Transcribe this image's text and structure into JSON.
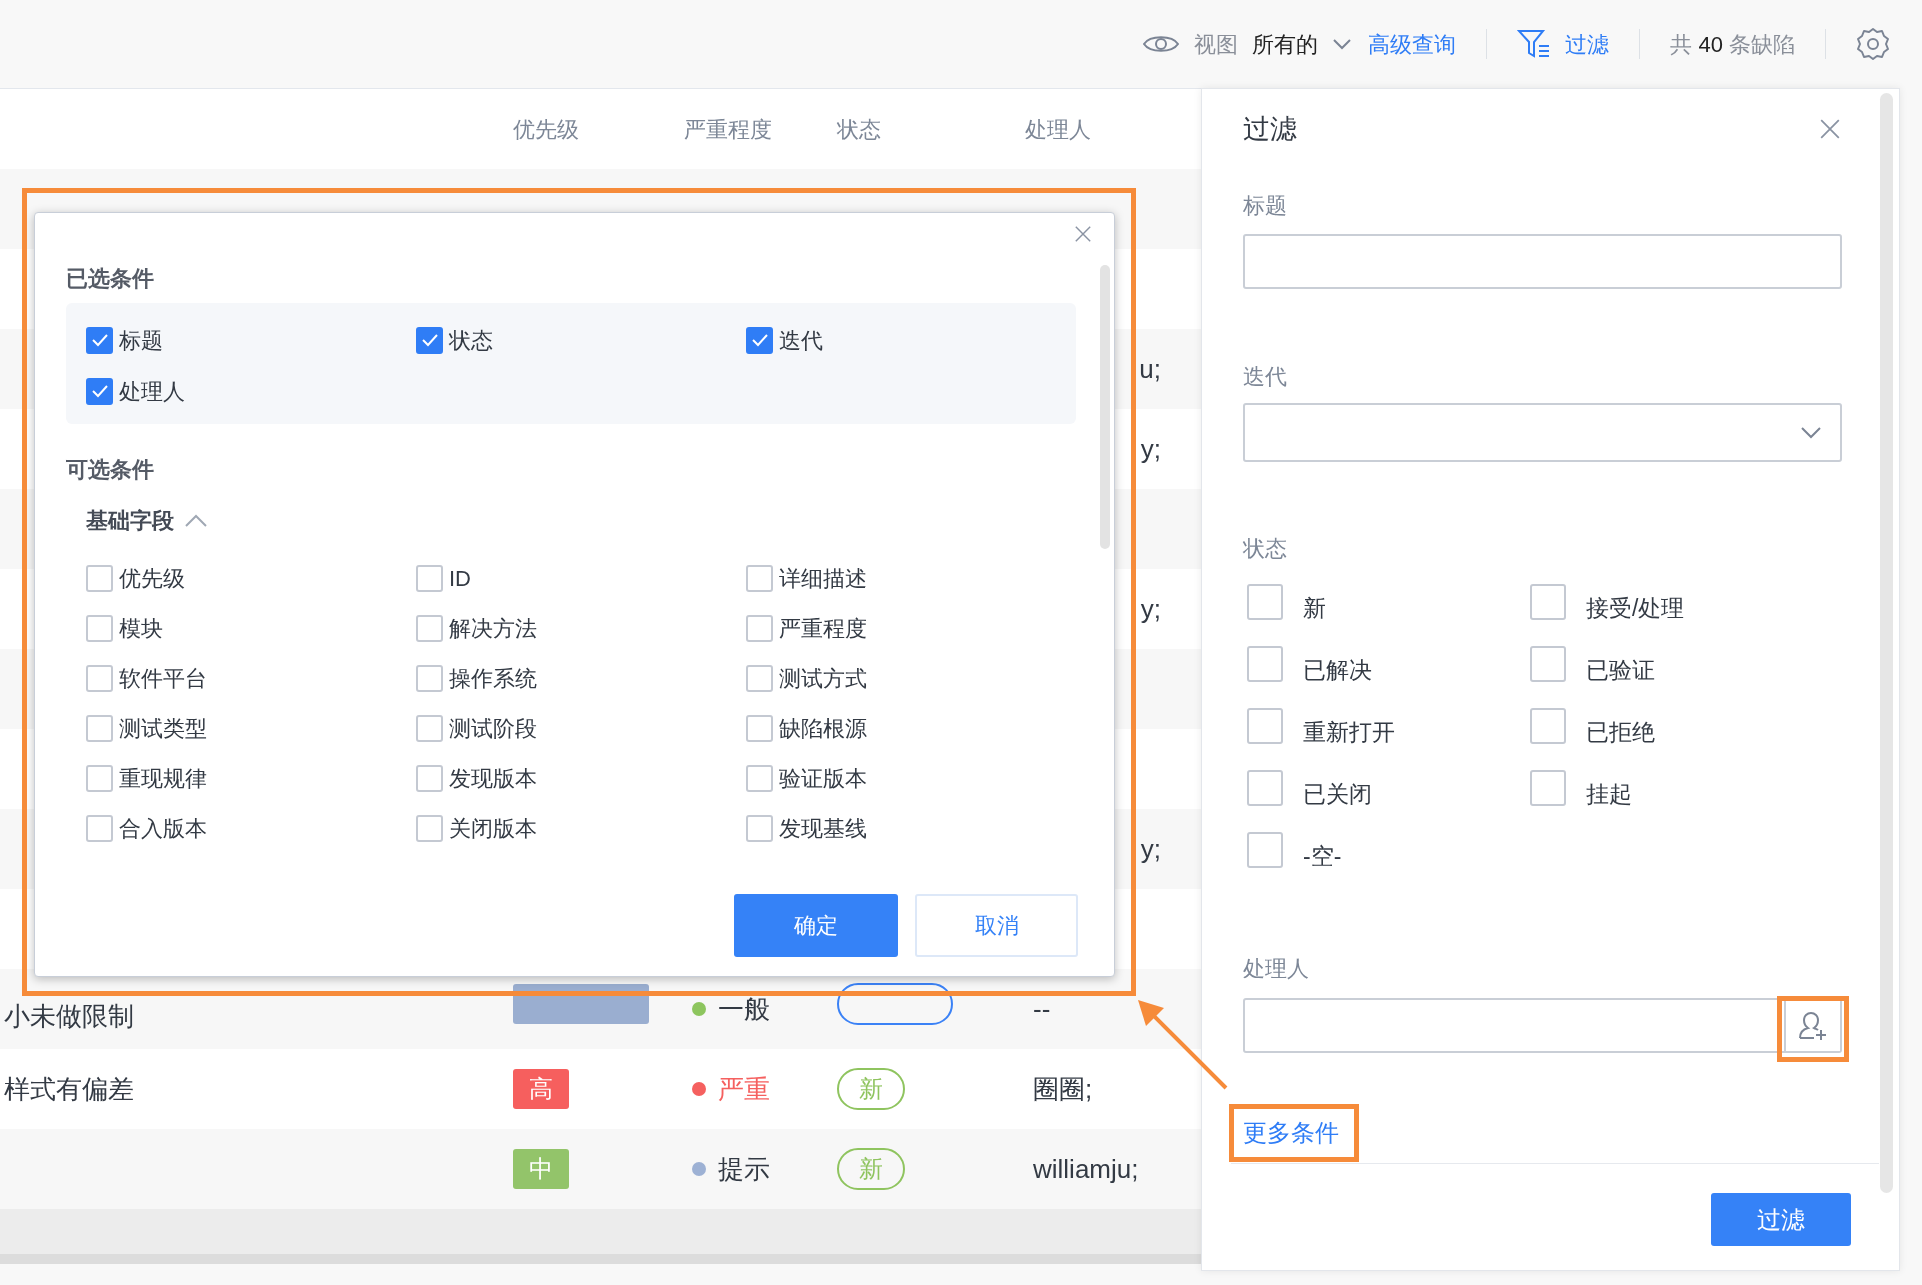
{
  "toolbar": {
    "view_label": "视图",
    "view_value": "所有的",
    "advanced_query": "高级查询",
    "filter_label": "过滤",
    "count_prefix": "共",
    "count_number": "40",
    "count_suffix": "条缺陷"
  },
  "table": {
    "columns": [
      "优先级",
      "严重程度",
      "状态",
      "处理人"
    ],
    "covered_rows": [
      {
        "kind": "covered"
      },
      {
        "kind": "covered"
      },
      {
        "kind": "covered",
        "assignee_tail": "u;"
      },
      {
        "kind": "covered",
        "assignee_tail": "y;"
      },
      {
        "kind": "covered"
      },
      {
        "kind": "covered",
        "assignee_tail": "y;"
      },
      {
        "kind": "covered"
      },
      {
        "kind": "covered"
      },
      {
        "kind": "covered",
        "assignee_tail": "y;"
      },
      {
        "kind": "covered"
      }
    ],
    "rows": [
      {
        "title": "小未做限制",
        "priority": {
          "kind": "none"
        },
        "severity": {
          "text": "一般",
          "kind": "normal",
          "color": "#8dc55e"
        },
        "status": {
          "kind": "resolved"
        },
        "assignee": "--"
      },
      {
        "title": "样式有偏差",
        "priority": {
          "text": "高",
          "kind": "high"
        },
        "severity": {
          "text": "严重",
          "kind": "critical",
          "color": "#f5605f"
        },
        "status": {
          "text": "新",
          "kind": "new"
        },
        "assignee": "圈圈;"
      },
      {
        "priority": {
          "text": "中",
          "kind": "medium"
        },
        "severity": {
          "text": "提示",
          "kind": "normal",
          "color": "#9db1d4"
        },
        "status": {
          "text": "新",
          "kind": "new"
        },
        "assignee": "williamju;"
      }
    ]
  },
  "condition_dialog": {
    "selected_title": "已选条件",
    "selected": [
      {
        "label": "标题",
        "checked": true
      },
      {
        "label": "状态",
        "checked": true
      },
      {
        "label": "迭代",
        "checked": true
      },
      {
        "label": "处理人",
        "checked": true
      }
    ],
    "optional_title": "可选条件",
    "group": {
      "title": "基础字段",
      "expanded": true
    },
    "options": [
      {
        "label": "优先级",
        "checked": false
      },
      {
        "label": "ID",
        "checked": false
      },
      {
        "label": "详细描述",
        "checked": false
      },
      {
        "label": "模块",
        "checked": false
      },
      {
        "label": "解决方法",
        "checked": false
      },
      {
        "label": "严重程度",
        "checked": false
      },
      {
        "label": "软件平台",
        "checked": false
      },
      {
        "label": "操作系统",
        "checked": false
      },
      {
        "label": "测试方式",
        "checked": false
      },
      {
        "label": "测试类型",
        "checked": false
      },
      {
        "label": "测试阶段",
        "checked": false
      },
      {
        "label": "缺陷根源",
        "checked": false
      },
      {
        "label": "重现规律",
        "checked": false
      },
      {
        "label": "发现版本",
        "checked": false
      },
      {
        "label": "验证版本",
        "checked": false
      },
      {
        "label": "合入版本",
        "checked": false
      },
      {
        "label": "关闭版本",
        "checked": false
      },
      {
        "label": "发现基线",
        "checked": false
      }
    ],
    "confirm": "确定",
    "cancel": "取消"
  },
  "filter_panel": {
    "title": "过滤",
    "fields": [
      {
        "kind": "text",
        "label": "标题"
      },
      {
        "kind": "select",
        "label": "迭代"
      },
      {
        "kind": "checkboxes",
        "label": "状态",
        "options": [
          {
            "label": "新",
            "checked": false
          },
          {
            "label": "接受/处理",
            "checked": false
          },
          {
            "label": "已解决",
            "checked": false
          },
          {
            "label": "已验证",
            "checked": false
          },
          {
            "label": "重新打开",
            "checked": false
          },
          {
            "label": "已拒绝",
            "checked": false
          },
          {
            "label": "已关闭",
            "checked": false
          },
          {
            "label": "挂起",
            "checked": false
          },
          {
            "label": "-空-",
            "checked": false
          }
        ]
      },
      {
        "kind": "user",
        "label": "处理人"
      }
    ],
    "more_conditions": "更多条件",
    "submit": "过滤"
  }
}
